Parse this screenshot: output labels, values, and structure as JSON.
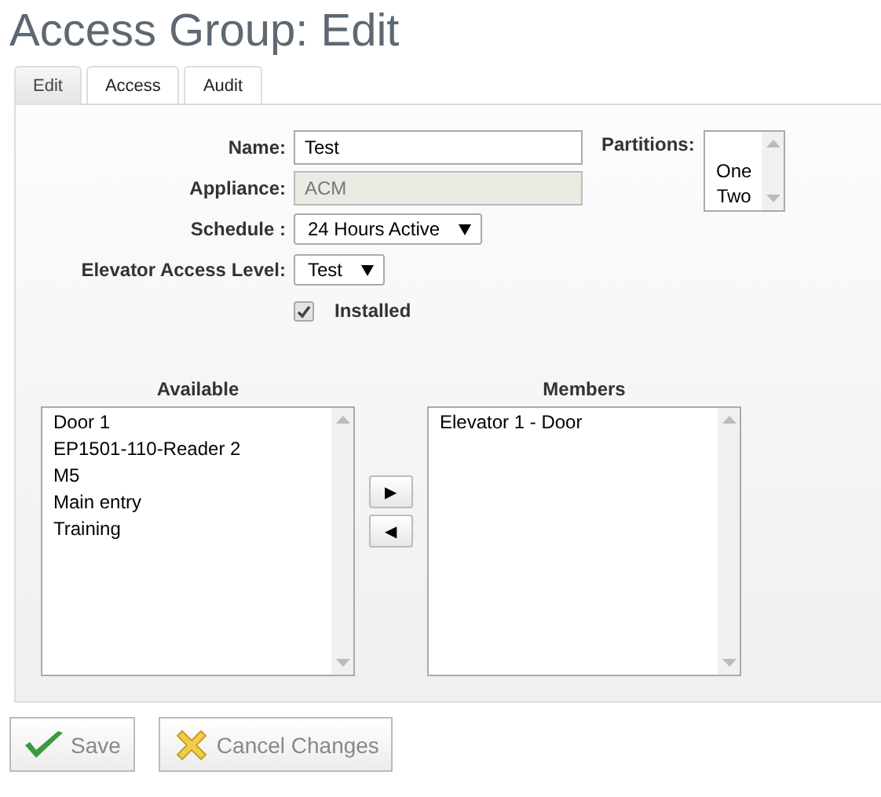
{
  "title": "Access Group: Edit",
  "tabs": [
    {
      "label": "Edit",
      "selected": true
    },
    {
      "label": "Access",
      "selected": false
    },
    {
      "label": "Audit",
      "selected": false
    }
  ],
  "fields": [
    {
      "kind": "text",
      "label": "Name:",
      "value": "Test",
      "disabled": false
    },
    {
      "kind": "text",
      "label": "Appliance:",
      "value": "ACM",
      "disabled": true
    },
    {
      "kind": "select",
      "label": "Schedule :",
      "value": "24 Hours Active",
      "disabled": false
    },
    {
      "kind": "select",
      "label": "Elevator Access Level:",
      "value": "Test",
      "disabled": false
    }
  ],
  "installed": {
    "label": "Installed",
    "checked": true
  },
  "partitions": {
    "label": "Partitions:",
    "items": [
      "One",
      "Two"
    ]
  },
  "available": {
    "heading": "Available",
    "items": [
      "Door 1",
      "EP1501-110-Reader 2",
      "M5",
      "Main entry",
      "Training"
    ]
  },
  "members": {
    "heading": "Members",
    "items": [
      "Elevator 1 - Door"
    ]
  },
  "move_buttons": [
    "▶",
    "◀"
  ],
  "actions": [
    {
      "kind": "save",
      "label": "Save"
    },
    {
      "kind": "cancel",
      "label": "Cancel Changes"
    }
  ]
}
